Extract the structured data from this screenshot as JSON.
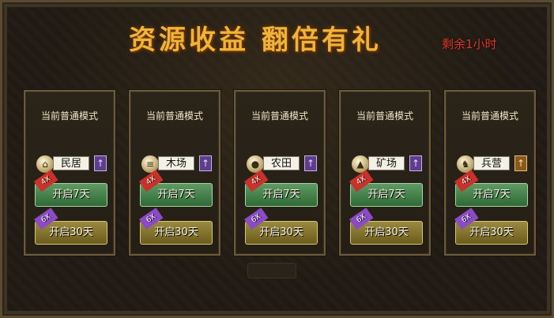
{
  "title": "资源收益 翻倍有礼",
  "remaining": "剩余1小时",
  "cards": [
    {
      "mode": "当前普通模式",
      "resource": "民居",
      "icon": "house-icon",
      "upgrade_icon": "arrow-up-icon",
      "btn7": "开启7天",
      "btn7_tag": "4X",
      "btn30": "开启30天",
      "btn30_tag": "6X"
    },
    {
      "mode": "当前普通模式",
      "resource": "木场",
      "icon": "wood-icon",
      "upgrade_icon": "arrow-up-icon",
      "btn7": "开启7天",
      "btn7_tag": "4X",
      "btn30": "开启30天",
      "btn30_tag": "6X"
    },
    {
      "mode": "当前普通模式",
      "resource": "农田",
      "icon": "grain-icon",
      "upgrade_icon": "arrow-up-icon",
      "btn7": "开启7天",
      "btn7_tag": "4X",
      "btn30": "开启30天",
      "btn30_tag": "6X"
    },
    {
      "mode": "当前普通模式",
      "resource": "矿场",
      "icon": "mine-icon",
      "upgrade_icon": "arrow-up-icon",
      "btn7": "开启7天",
      "btn7_tag": "4X",
      "btn30": "开启30天",
      "btn30_tag": "6X"
    },
    {
      "mode": "当前普通模式",
      "resource": "兵营",
      "icon": "barracks-icon",
      "upgrade_icon": "arrow-up-icon",
      "btn7": "开启7天",
      "btn7_tag": "4X",
      "btn30": "开启30天",
      "btn30_tag": "6X"
    }
  ]
}
